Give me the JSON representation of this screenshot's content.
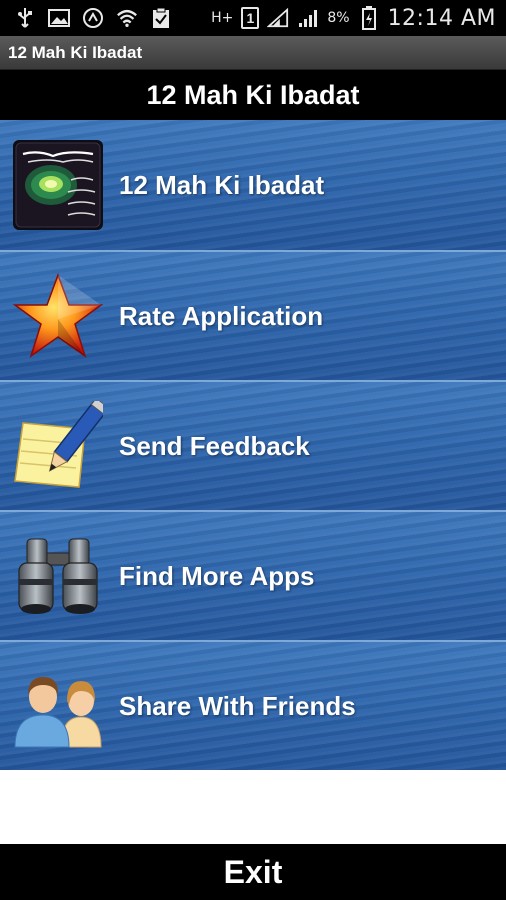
{
  "status_bar": {
    "icons_left": [
      "usb-icon",
      "image-icon",
      "sync-icon",
      "wifi-icon",
      "clipboard-icon"
    ],
    "network_type": "H+",
    "sim_slot": "1",
    "battery_percent": "8%",
    "time": "12:14 AM"
  },
  "app_title_bar": {
    "title": "12 Mah Ki Ibadat"
  },
  "header": {
    "title": "12 Mah Ki Ibadat"
  },
  "menu": {
    "items": [
      {
        "label": "12 Mah Ki Ibadat",
        "icon": "book-cover-icon"
      },
      {
        "label": "Rate Application",
        "icon": "star-icon"
      },
      {
        "label": "Send Feedback",
        "icon": "notepad-pencil-icon"
      },
      {
        "label": "Find More Apps",
        "icon": "binoculars-icon"
      },
      {
        "label": "Share With Friends",
        "icon": "people-icon"
      }
    ]
  },
  "exit_button": {
    "label": "Exit"
  },
  "colors": {
    "menu_blue": "#2e66ad",
    "bar_black": "#000000",
    "title_gray": "#4a4a4a"
  }
}
